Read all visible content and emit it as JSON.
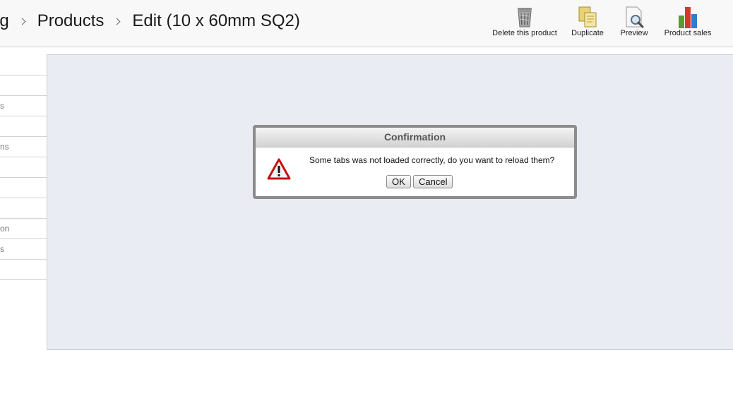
{
  "breadcrumb": {
    "items": [
      "og",
      "Products",
      "Edit (10 x 60mm SQ2)"
    ]
  },
  "toolbar": {
    "delete_label": "Delete this product",
    "duplicate_label": "Duplicate",
    "preview_label": "Preview",
    "sales_label": "Product sales",
    "icons": [
      "trash-icon",
      "duplicate-icon",
      "preview-icon",
      "bar-chart-icon"
    ]
  },
  "sidebar": {
    "items": [
      {
        "label": ""
      },
      {
        "label": ""
      },
      {
        "label": "s"
      },
      {
        "label": ""
      },
      {
        "label": "ns"
      },
      {
        "label": ""
      },
      {
        "label": ""
      },
      {
        "label": ""
      },
      {
        "label": "on"
      },
      {
        "label": "s"
      },
      {
        "label": ""
      }
    ]
  },
  "dialog": {
    "title": "Confirmation",
    "message": "Some tabs was not loaded correctly, do you want to reload them?",
    "ok_label": "OK",
    "cancel_label": "Cancel",
    "icon": "warning-icon"
  },
  "colors": {
    "main_background": "#e9ecf3",
    "dialog_border": "#8c8c8c",
    "warning_red": "#cc1111"
  }
}
